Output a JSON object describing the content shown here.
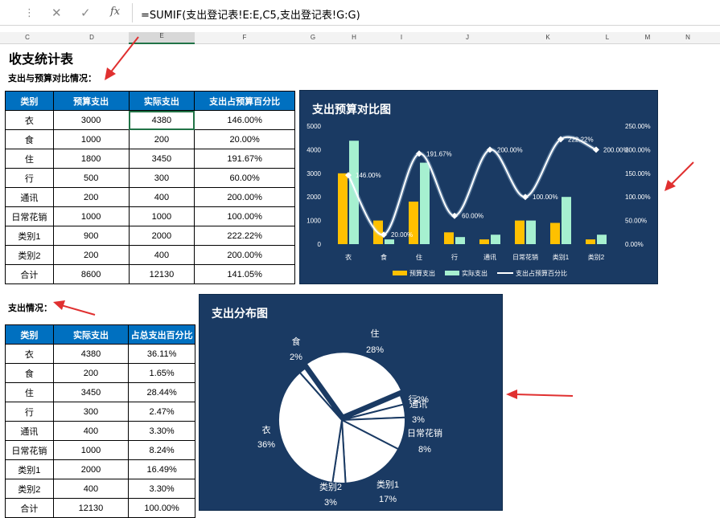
{
  "formula_bar": {
    "dots": "⋮",
    "cancel": "✕",
    "enter": "✓",
    "fx": "fx",
    "formula": "=SUMIF(支出登记表!E:E,C5,支出登记表!G:G)"
  },
  "columns": [
    "C",
    "D",
    "E",
    "F",
    "G",
    "H",
    "I",
    "J",
    "K",
    "L",
    "M",
    "N"
  ],
  "title": "收支统计表",
  "subtitle1": "支出与预算对比情况：",
  "subtitle2": "支出情况：",
  "table1": {
    "headers": [
      "类别",
      "预算支出",
      "实际支出",
      "支出占预算百分比"
    ],
    "rows": [
      [
        "衣",
        "3000",
        "4380",
        "146.00%"
      ],
      [
        "食",
        "1000",
        "200",
        "20.00%"
      ],
      [
        "住",
        "1800",
        "3450",
        "191.67%"
      ],
      [
        "行",
        "500",
        "300",
        "60.00%"
      ],
      [
        "通讯",
        "200",
        "400",
        "200.00%"
      ],
      [
        "日常花销",
        "1000",
        "1000",
        "100.00%"
      ],
      [
        "类别1",
        "900",
        "2000",
        "222.22%"
      ],
      [
        "类别2",
        "200",
        "400",
        "200.00%"
      ],
      [
        "合计",
        "8600",
        "12130",
        "141.05%"
      ]
    ]
  },
  "table2": {
    "headers": [
      "类别",
      "实际支出",
      "占总支出百分比"
    ],
    "rows": [
      [
        "衣",
        "4380",
        "36.11%"
      ],
      [
        "食",
        "200",
        "1.65%"
      ],
      [
        "住",
        "3450",
        "28.44%"
      ],
      [
        "行",
        "300",
        "2.47%"
      ],
      [
        "通讯",
        "400",
        "3.30%"
      ],
      [
        "日常花销",
        "1000",
        "8.24%"
      ],
      [
        "类别1",
        "2000",
        "16.49%"
      ],
      [
        "类别2",
        "400",
        "3.30%"
      ],
      [
        "合计",
        "12130",
        "100.00%"
      ]
    ]
  },
  "colors": {
    "budget": "#ffc000",
    "actual": "#a6f0d0",
    "line": "#ffffff",
    "chart_bg": "#1a3a63",
    "header": "#0070c0",
    "arrow": "#e03030"
  },
  "chart_data": [
    {
      "type": "bar",
      "title": "支出预算对比图",
      "categories": [
        "衣",
        "食",
        "住",
        "行",
        "通讯",
        "日常花销",
        "类别1",
        "类别2"
      ],
      "series": [
        {
          "name": "预算支出",
          "values": [
            3000,
            1000,
            1800,
            500,
            200,
            1000,
            900,
            200
          ]
        },
        {
          "name": "实际支出",
          "values": [
            4380,
            200,
            3450,
            300,
            400,
            1000,
            2000,
            400
          ]
        },
        {
          "name": "支出占预算百分比",
          "type": "line",
          "axis": "right",
          "values": [
            146.0,
            20.0,
            191.67,
            60.0,
            200.0,
            100.0,
            222.22,
            200.0
          ],
          "labels": [
            "146.00%",
            "20.00%",
            "191.67%",
            "60.00%",
            "200.00%",
            "100.00%",
            "222.22%",
            "200.00%"
          ]
        }
      ],
      "y_ticks": [
        "0",
        "1000",
        "2000",
        "3000",
        "4000",
        "5000"
      ],
      "y2_ticks": [
        "0.00%",
        "50.00%",
        "100.00%",
        "150.00%",
        "200.00%",
        "250.00%"
      ],
      "ylim": [
        0,
        5000
      ],
      "y2lim": [
        0,
        250
      ],
      "legend": "bottom"
    },
    {
      "type": "pie",
      "title": "支出分布图",
      "labels": [
        "住",
        "行",
        "通讯",
        "日常花销",
        "类别1",
        "类别2",
        "衣",
        "食"
      ],
      "values": [
        3450,
        300,
        400,
        1000,
        2000,
        400,
        4380,
        200
      ],
      "pct_labels": [
        "28%",
        "2%",
        "3%",
        "8%",
        "17%",
        "3%",
        "36%",
        "2%"
      ]
    }
  ]
}
